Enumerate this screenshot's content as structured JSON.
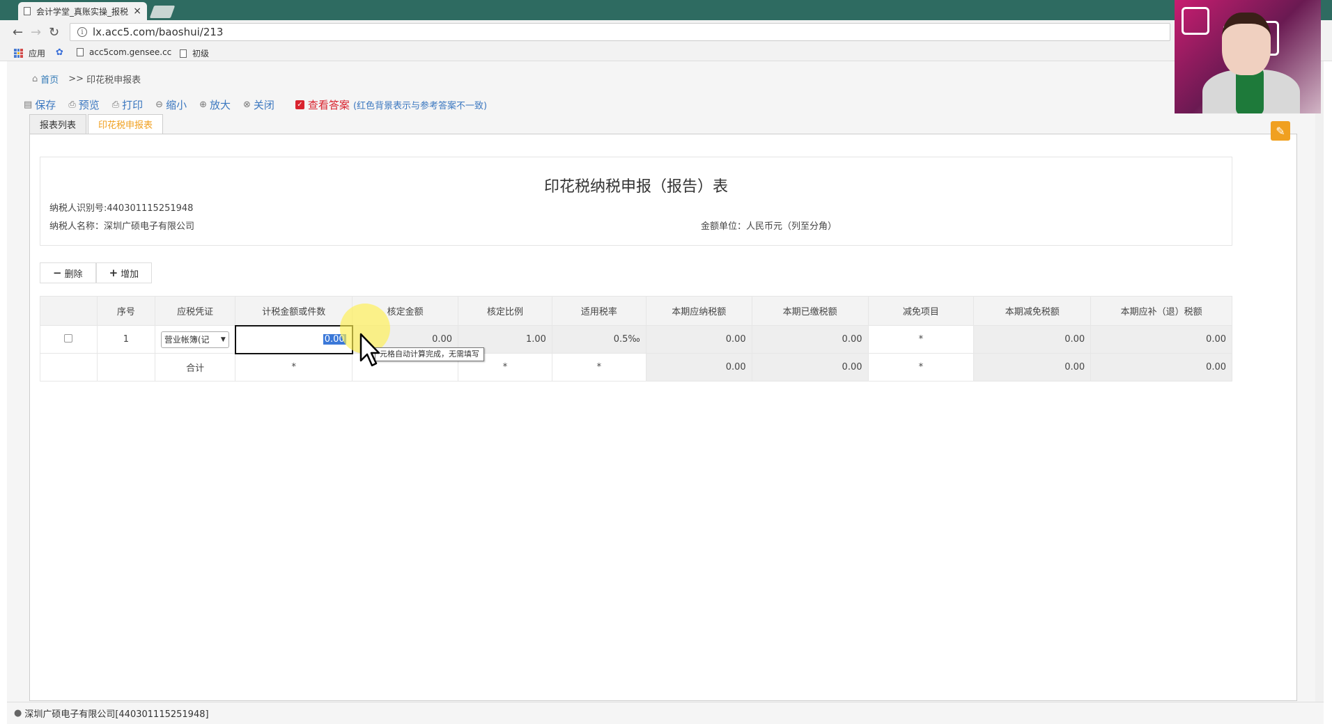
{
  "browser": {
    "tab_title": "会计学堂_真账实操_报税",
    "url": "lx.acc5.com/baoshui/213",
    "bookmarks": [
      "应用",
      "acc5com.gensee.cc",
      "初级"
    ]
  },
  "breadcrumb": {
    "home": "首页",
    "separator": ">>",
    "current": "印花税申报表"
  },
  "toolbar": {
    "save": "保存",
    "preview": "预览",
    "print": "打印",
    "zoom_out": "缩小",
    "zoom_in": "放大",
    "close": "关闭",
    "view_answer": "查看答案",
    "answer_note": "(红色背景表示与参考答案不一致)"
  },
  "tabs": [
    {
      "label": "报表列表"
    },
    {
      "label": "印花税申报表"
    }
  ],
  "form": {
    "title": "印花税纳税申报（报告）表",
    "taxpayer_id": "纳税人识别号:440301115251948",
    "taxpayer_name": "纳税人名称：深圳广硕电子有限公司",
    "unit": "金额单位：人民币元（列至分角）"
  },
  "row_buttons": {
    "delete": "删除",
    "add": "增加"
  },
  "table": {
    "headers": [
      "",
      "序号",
      "应税凭证",
      "计税金额或件数",
      "核定金额",
      "核定比例",
      "适用税率",
      "本期应纳税额",
      "本期已缴税额",
      "减免项目",
      "本期减免税额",
      "本期应补（退）税额"
    ],
    "row1": {
      "seq": "1",
      "voucher": "营业帐簿(记",
      "amount": "0.00",
      "approved_amount": "0.00",
      "ratio": "1.00",
      "rate": "0.5‰",
      "payable": "0.00",
      "paid": "0.00",
      "relief_item": "*",
      "relief": "0.00",
      "due": "0.00"
    },
    "total": {
      "label": "合计",
      "amount": "*",
      "ratio": "*",
      "rate": "*",
      "payable": "0.00",
      "paid": "0.00",
      "relief_item": "*",
      "relief": "0.00",
      "due": "0.00"
    }
  },
  "tooltip": "元格自动计算完成，无需填写",
  "status": {
    "company": "深圳广硕电子有限公司[440301115251948]"
  },
  "colors": {
    "tabstrip": "#2e6b61",
    "link": "#3c78c0",
    "accent": "#f0a020",
    "error": "#d9232e"
  }
}
